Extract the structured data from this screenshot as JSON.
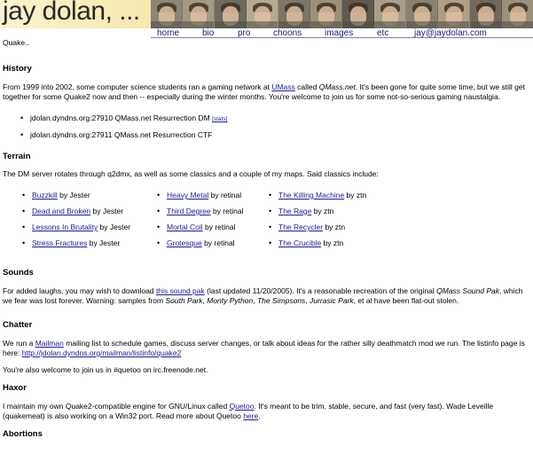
{
  "header": {
    "title": "jay dolan, ...",
    "nav": [
      {
        "label": "home"
      },
      {
        "label": "bio"
      },
      {
        "label": "pro"
      },
      {
        "label": "choons"
      },
      {
        "label": "images"
      },
      {
        "label": "etc"
      },
      {
        "label": "jay@jaydolan.com"
      }
    ]
  },
  "intro": "Quake..",
  "history": {
    "heading": "History",
    "text_1": "From 1999 into 2002, some computer science students ran a gaming network at ",
    "link_umass": "UMass",
    "text_2": " called ",
    "qmass": "QMass.net",
    "text_3": ". It's been gone for quite some time, but we still get together for some Quake2 now and then -- especially during the winter months. You're welcome to join us for some not-so-serious gaming naustalgia.",
    "servers": [
      {
        "text": "jdolan.dyndns.org:27910 QMass.net Resurrection DM ",
        "extra": "[stats]"
      },
      {
        "text": "jdolan.dyndns.org:27911 QMass.net Resurrection CTF",
        "extra": ""
      }
    ]
  },
  "terrain": {
    "heading": "Terrain",
    "text": "The DM server rotates through q2dmx, as well as some classics and a couple of my maps. Said classics include:",
    "columns": [
      [
        {
          "map": "Buzzkill",
          "author": " by Jester"
        },
        {
          "map": "Dead and Broken",
          "author": " by Jester"
        },
        {
          "map": "Lessons In Brutality",
          "author": " by Jester"
        },
        {
          "map": "Stress Fractures",
          "author": " by Jester"
        }
      ],
      [
        {
          "map": "Heavy Metal",
          "author": " by retinal"
        },
        {
          "map": "Third Degree",
          "author": " by retinal"
        },
        {
          "map": "Mortal Coil",
          "author": " by retinal"
        },
        {
          "map": "Grotesque",
          "author": " by retinal"
        }
      ],
      [
        {
          "map": "The Killing Machine",
          "author": " by ztn"
        },
        {
          "map": "The Rage",
          "author": " by ztn"
        },
        {
          "map": "The Recycler",
          "author": " by ztn"
        },
        {
          "map": "The Crucible",
          "author": " by ztn"
        }
      ]
    ]
  },
  "sounds": {
    "heading": "Sounds",
    "t1": "For added laughs, you may wish to download ",
    "link": "this sound pak",
    "t2": " (last updated 11/20/2005). It's a reasonable recreation of the original ",
    "pak": "QMass Sound Pak",
    "t3": ", which we fear was lost forever. Warning: samples from ",
    "sp": "South Park",
    "c1": ", ",
    "mp": "Monty Python",
    "c2": ", ",
    "simp": "The Simpsons",
    "c3": ", ",
    "jp": "Jurrasic Park",
    "t4": ", et al have been flat-out stolen."
  },
  "chatter": {
    "heading": "Chatter",
    "t1": "We run a ",
    "mailman": "Mailman",
    "t2": " mailing list to schedule games, discuss server changes, or talk about ideas for the rather silly deathmatch mod we run. The listinfo page is here: ",
    "listinfo": "http://jdolan.dyndns.org/mailman/listinfo/quake2",
    "p2": "You're also welcome to join us in #quetoo on irc.freenode.net."
  },
  "haxor": {
    "heading": "Haxor",
    "t1": "I maintain my own Quake2-compatible engine for GNU/Linux called ",
    "quetoo": "Quetoo",
    "t2": ". It's meant to be trim, stable, secure, and fast (very fast). Wade Leveille (quakemeat) is also working on a Win32 port. Read more about Quetoo ",
    "here": "here",
    "t3": "."
  },
  "next_heading": "Abortions"
}
